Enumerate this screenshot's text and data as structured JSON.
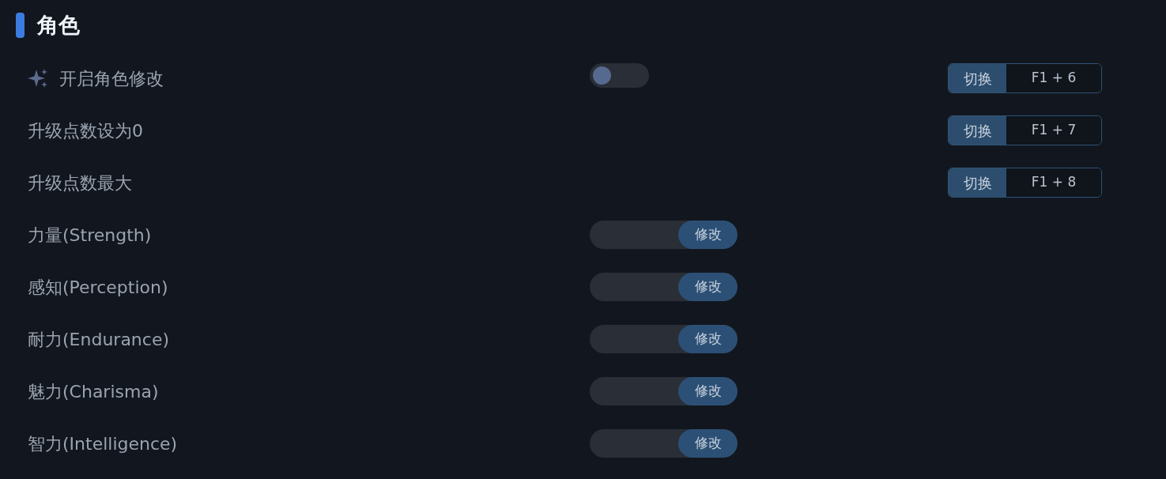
{
  "section": {
    "title": "角色"
  },
  "rows": [
    {
      "kind": "toggle",
      "label": "开启角色修改",
      "on": false,
      "hotkey": {
        "action": "切换",
        "keys": "F1 + 6"
      }
    },
    {
      "kind": "action",
      "label": "升级点数设为0",
      "hotkey": {
        "action": "切换",
        "keys": "F1 + 7"
      }
    },
    {
      "kind": "action",
      "label": "升级点数最大",
      "hotkey": {
        "action": "切换",
        "keys": "F1 + 8"
      }
    },
    {
      "kind": "input",
      "label": "力量(Strength)",
      "button": "修改"
    },
    {
      "kind": "input",
      "label": "感知(Perception)",
      "button": "修改"
    },
    {
      "kind": "input",
      "label": "耐力(Endurance)",
      "button": "修改"
    },
    {
      "kind": "input",
      "label": "魅力(Charisma)",
      "button": "修改"
    },
    {
      "kind": "input",
      "label": "智力(Intelligence)",
      "button": "修改"
    }
  ]
}
